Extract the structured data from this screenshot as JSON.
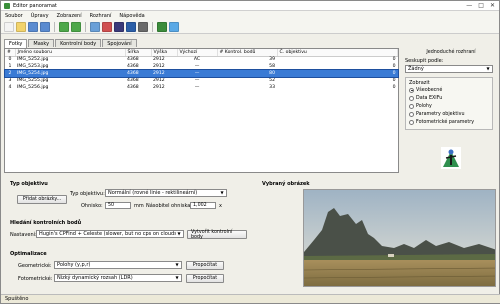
{
  "window": {
    "title": "Editor panoramat",
    "min_glyph": "—",
    "max_glyph": "□",
    "close_glyph": "✕"
  },
  "menu": [
    "Soubor",
    "Úpravy",
    "Zobrazení",
    "Rozhraní",
    "Nápověda"
  ],
  "toolbar": {
    "icons": [
      "new-icon",
      "open-icon",
      "save-icon",
      "save-as-icon",
      "undo-icon",
      "redo-icon",
      "add-images-icon",
      "remove-images-icon",
      "control-points-icon",
      "optimize-icon",
      "stitch-icon",
      "gallery-icon",
      "preview-icon"
    ],
    "colors": [
      "#f3f3f3",
      "#f2d36b",
      "#5a8bd0",
      "#5a8bd0",
      "#4ea84a",
      "#4ea84a",
      "#6aa0d8",
      "#d05050",
      "#3a3a7a",
      "#2c5fa8",
      "#6a6a6a",
      "#3b8c3b",
      "#5aa9e6"
    ]
  },
  "tabs": [
    "Fotky",
    "Masky",
    "Kontrolní body",
    "Spojování"
  ],
  "table": {
    "columns": [
      "#",
      "Jméno souboru",
      "Šířka",
      "Výška",
      "Výchozí",
      "# Kontrol. bodů",
      "Č. objektivu"
    ],
    "rows": [
      [
        "0",
        "IMG_5252.jpg",
        "4368",
        "2912",
        "AC",
        "39",
        "0"
      ],
      [
        "1",
        "IMG_5253.jpg",
        "4368",
        "2912",
        "—",
        "58",
        "0"
      ],
      [
        "2",
        "IMG_5254.jpg",
        "4368",
        "2912",
        "—",
        "80",
        "0"
      ],
      [
        "3",
        "IMG_5255.jpg",
        "4368",
        "2912",
        "—",
        "52",
        "0"
      ],
      [
        "4",
        "IMG_5256.jpg",
        "4368",
        "2912",
        "—",
        "33",
        "0"
      ]
    ],
    "selected_index": 2
  },
  "right_panel": {
    "mode_label": "Jednoduché rozhraní",
    "group_label": "Seskupit podle:",
    "group_value": "Žádný",
    "show_label": "Zobrazit",
    "radios": [
      "Všeobecné",
      "Data EXIFu",
      "Polohy",
      "Parametry objektivu",
      "Fotometrické parametry"
    ],
    "radio_selected": 0,
    "logo": "hugin-logo"
  },
  "lens": {
    "heading": "Typ objektivu",
    "add_button": "Přidat obrázky...",
    "type_label": "Typ objektivu:",
    "type_value": "Normální (rovné linie - rektilineární)",
    "focal_label": "Ohnisko:",
    "focal_value": "50",
    "focal_unit": "mm",
    "crop_label": "Násobitel ohniska:",
    "crop_value": "1,002",
    "crop_unit": "x"
  },
  "cp": {
    "heading": "Hledání kontrolních bodů",
    "setting_label": "Nastavení:",
    "setting_value": "Hugin's CPFind + Celeste (slower, but no cps on clouds)",
    "create_button": "Vytvořit kontrolní body"
  },
  "optimize": {
    "heading": "Optimalizace",
    "geo_label": "Geometrické:",
    "geo_value": "Polohy (y,p,r)",
    "geo_button": "Propočítat",
    "photo_label": "Fotometrické:",
    "photo_value": "Nízký dynamický rozsah (LDR)",
    "photo_button": "Propočítat"
  },
  "preview": {
    "heading": "Vybraný obrázek"
  },
  "status": "Spuštěno"
}
